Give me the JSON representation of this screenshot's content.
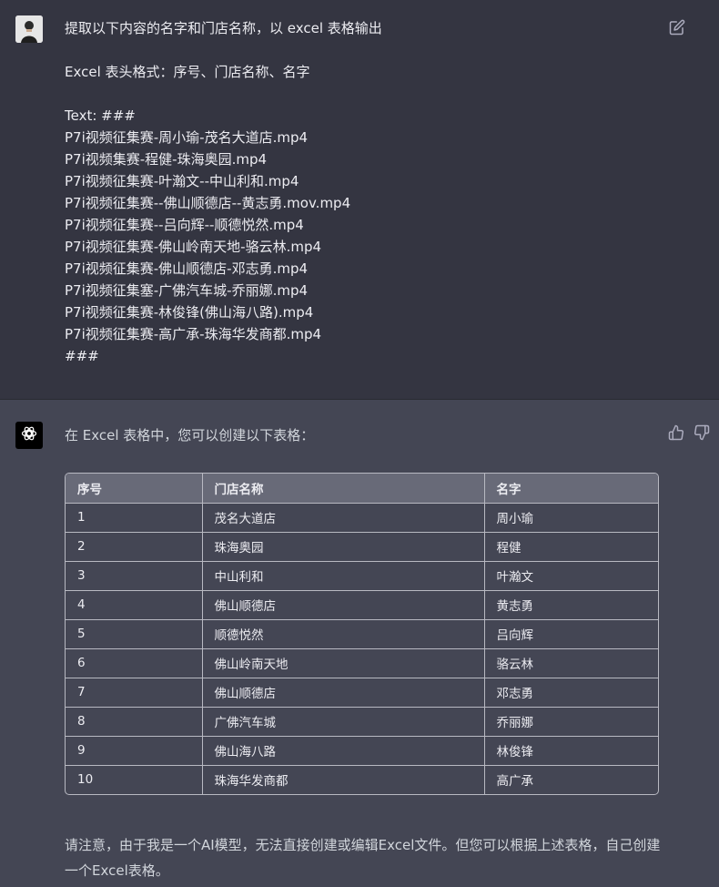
{
  "user_message": {
    "lines": [
      "提取以下内容的名字和门店名称，以 excel 表格输出",
      "",
      "Excel 表头格式：序号、门店名称、名字",
      "",
      "Text: ###",
      "P7i视频征集赛-周小瑜-茂名大道店.mp4",
      "P7i视频集赛-程健-珠海奥园.mp4",
      "P7i视频征集赛-叶瀚文--中山利和.mp4",
      "P7i视频征集赛--佛山顺德店--黄志勇.mov.mp4",
      "P7i视频征集赛--吕向辉--顺德悦然.mp4",
      "P7i视频征集赛-佛山岭南天地-骆云林.mp4",
      "P7i视频征集赛-佛山顺德店-邓志勇.mp4",
      "P7i视频征集塞-广佛汽车城-乔丽娜.mp4",
      "P7i视频征集赛-林俊锋(佛山海八路).mp4",
      "P7i视频征集赛-高广承-珠海华发商都.mp4",
      "###"
    ]
  },
  "assistant_message": {
    "intro": "在 Excel 表格中，您可以创建以下表格：",
    "table": {
      "headers": [
        "序号",
        "门店名称",
        "名字"
      ],
      "rows": [
        [
          "1",
          "茂名大道店",
          "周小瑜"
        ],
        [
          "2",
          "珠海奥园",
          "程健"
        ],
        [
          "3",
          "中山利和",
          "叶瀚文"
        ],
        [
          "4",
          "佛山顺德店",
          "黄志勇"
        ],
        [
          "5",
          "顺德悦然",
          "吕向辉"
        ],
        [
          "6",
          "佛山岭南天地",
          "骆云林"
        ],
        [
          "7",
          "佛山顺德店",
          "邓志勇"
        ],
        [
          "8",
          "广佛汽车城",
          "乔丽娜"
        ],
        [
          "9",
          "佛山海八路",
          "林俊锋"
        ],
        [
          "10",
          "珠海华发商都",
          "高广承"
        ]
      ]
    },
    "note": "请注意，由于我是一个AI模型，无法直接创建或编辑Excel文件。但您可以根据上述表格，自己创建一个Excel表格。"
  },
  "icons": {
    "edit": "edit-icon",
    "thumbs_up": "thumbs-up-icon",
    "thumbs_down": "thumbs-down-icon",
    "bot_logo": "openai-logo-icon"
  },
  "colors": {
    "user_bg": "#343541",
    "assistant_bg": "#444654",
    "table_header_bg": "#686a78",
    "bot_avatar_bg": "#000000"
  }
}
